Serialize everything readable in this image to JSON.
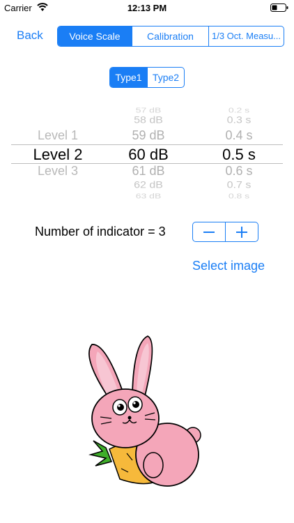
{
  "status_bar": {
    "carrier": "Carrier",
    "time": "12:13 PM"
  },
  "nav": {
    "back_label": "Back",
    "tabs": [
      "Voice Scale",
      "Calibration",
      "1/3 Oct. Measu..."
    ],
    "selected_tab": 0
  },
  "type_toggle": {
    "options": [
      "Type1",
      "Type2"
    ],
    "selected": 0
  },
  "picker": {
    "level": [
      "Level 1",
      "Level 2",
      "Level 3"
    ],
    "db": [
      "57 dB",
      "58 dB",
      "59 dB",
      "60 dB",
      "61 dB",
      "62 dB",
      "63 dB"
    ],
    "seconds": [
      "0.2 s",
      "0.3 s",
      "0.4 s",
      "0.5 s",
      "0.6 s",
      "0.7 s",
      "0.8 s"
    ],
    "selected": {
      "level": "Level 2",
      "db": "60 dB",
      "seconds": "0.5 s"
    }
  },
  "indicator": {
    "label": "Number of indicator = 3",
    "minus": "−",
    "plus": "+"
  },
  "select_image_label": "Select image",
  "colors": {
    "accent": "#1a7ef5",
    "rabbit": "#f4a6b9",
    "carrot": "#f6b93b",
    "leaves": "#3fae2a"
  }
}
